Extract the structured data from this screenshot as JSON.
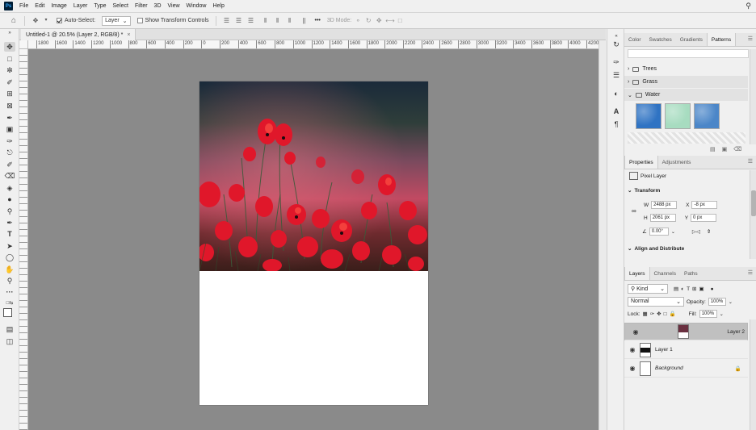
{
  "menubar": {
    "logo": "Ps",
    "items": [
      "File",
      "Edit",
      "Image",
      "Layer",
      "Type",
      "Select",
      "Filter",
      "3D",
      "View",
      "Window",
      "Help"
    ],
    "search_icon": "search-icon"
  },
  "options_bar": {
    "auto_select_label": "Auto-Select:",
    "auto_select_value": "Layer",
    "show_transform_label": "Show Transform Controls",
    "three_d_mode_label": "3D Mode:",
    "more_label": "•••"
  },
  "document": {
    "tab_title": "Untitled-1 @ 20.5% (Layer 2, RGB/8) *",
    "close_glyph": "×",
    "ruler_labels": [
      "1800",
      "1600",
      "1400",
      "1200",
      "1000",
      "800",
      "600",
      "400",
      "200",
      "0",
      "200",
      "400",
      "600",
      "800",
      "1000",
      "1200",
      "1400",
      "1600",
      "1800",
      "2000",
      "2200",
      "2400",
      "2600",
      "2800",
      "3000",
      "3200",
      "3400",
      "3600",
      "3800",
      "4000",
      "4200"
    ]
  },
  "patterns_panel": {
    "tabs": [
      "Color",
      "Swatches",
      "Gradients",
      "Patterns"
    ],
    "active_tab": "Patterns",
    "groups": [
      "Trees",
      "Grass",
      "Water"
    ],
    "swatch_colors": [
      "#2f73c3",
      "#a7dcc0",
      "#4b86c8"
    ]
  },
  "properties_panel": {
    "tabs": [
      "Properties",
      "Adjustments"
    ],
    "type_label": "Pixel Layer",
    "transform_title": "Transform",
    "w_label": "W",
    "w_value": "2488 px",
    "x_label": "X",
    "x_value": "-8 px",
    "h_label": "H",
    "h_value": "2061 px",
    "y_label": "Y",
    "y_value": "0 px",
    "angle_value": "0.00°",
    "align_title": "Align and Distribute"
  },
  "layers_panel": {
    "tabs": [
      "Layers",
      "Channels",
      "Paths"
    ],
    "kind_label": "Kind",
    "blend_mode": "Normal",
    "opacity_label": "Opacity:",
    "opacity_value": "100%",
    "lock_label": "Lock:",
    "fill_label": "Fill:",
    "fill_value": "100%",
    "layers": [
      {
        "name": "Layer 2",
        "selected": true
      },
      {
        "name": "Layer 1",
        "selected": false
      },
      {
        "name": "Background",
        "selected": false
      }
    ]
  },
  "colors": {
    "canvas_bg": "#8a8a8a",
    "ui_bg": "#f0f0f0",
    "selected_layer": "#c0c0c0"
  }
}
